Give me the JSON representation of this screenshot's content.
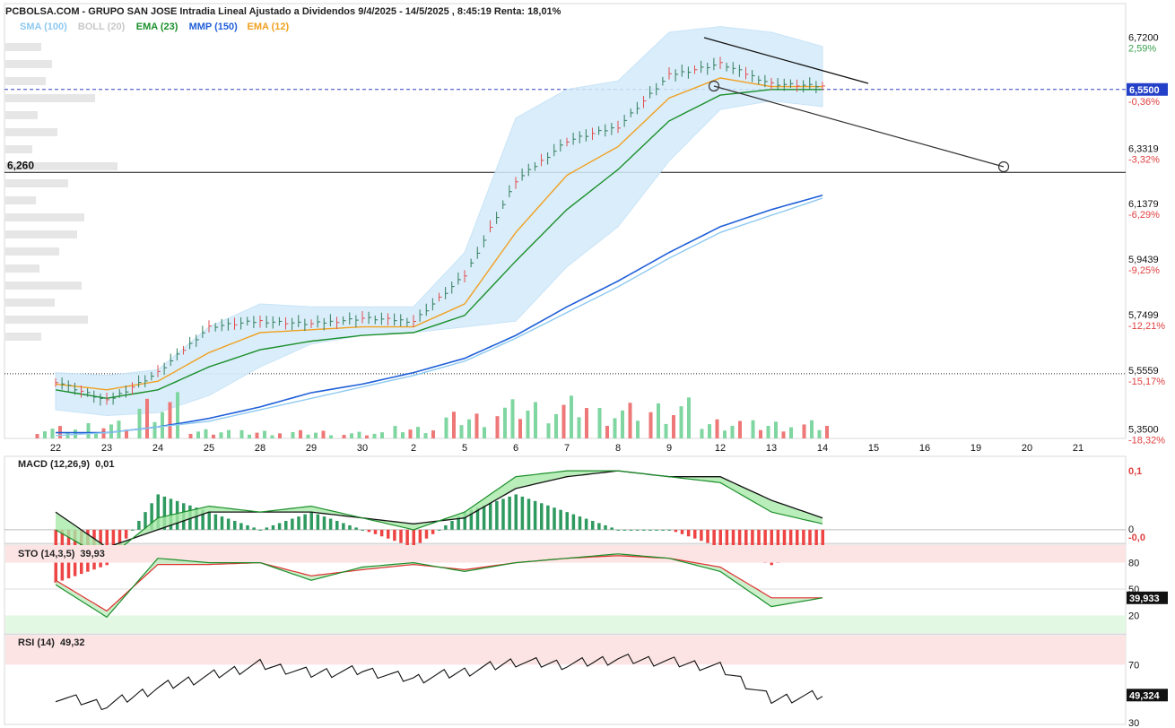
{
  "header": {
    "title": "PCBOLSA.COM - GRUPO SAN JOSE Intradia Lineal Ajustado a Dividendos 9/4/2025 - 14/5/2025 , 8:45:19 Renta: 18,01%"
  },
  "legend": [
    {
      "label": "SMA (100)",
      "color": "#8ec9f0"
    },
    {
      "label": "BOLL (20)",
      "color": "#c8c8c8"
    },
    {
      "label": "EMA (23)",
      "color": "#1a8f2a"
    },
    {
      "label": "MMP (150)",
      "color": "#1f5fd8"
    },
    {
      "label": "EMA (12)",
      "color": "#f0a020"
    }
  ],
  "price_axis": {
    "ticks": [
      {
        "price": "6,7200",
        "pct": "2,59%",
        "y": 6.72
      },
      {
        "price": "6,3319",
        "pct": "-3,32%",
        "y": 6.3319
      },
      {
        "price": "6,1379",
        "pct": "-6,29%",
        "y": 6.1379
      },
      {
        "price": "5,9439",
        "pct": "-9,25%",
        "y": 5.9439
      },
      {
        "price": "5,7499",
        "pct": "-12,21%",
        "y": 5.7499
      },
      {
        "price": "5,5559",
        "pct": "-15,17%",
        "y": 5.5559
      },
      {
        "price": "5,3500",
        "pct": "-18,32%",
        "y": 5.35
      }
    ],
    "current_price": "6,5500",
    "current_pct": "-0,36%",
    "current_value": 6.55,
    "level_label": "6,260",
    "level_value": 6.26,
    "dotted_level": 5.5559
  },
  "x_axis": {
    "labels": [
      "22",
      "23",
      "24",
      "25",
      "28",
      "29",
      "30",
      "2",
      "5",
      "6",
      "7",
      "8",
      "9",
      "12",
      "13",
      "14",
      "15",
      "16",
      "19",
      "20",
      "21"
    ]
  },
  "macd": {
    "label": "MACD (12,26,9)",
    "value": "0,01",
    "axis_top": "0,1",
    "axis_zero": "0",
    "badge": "-0,0"
  },
  "sto": {
    "label": "STO (14,3,5)",
    "value": "39,93",
    "ticks": [
      "80",
      "50",
      "20"
    ],
    "badge": "39,933"
  },
  "rsi": {
    "label": "RSI (14)",
    "value": "49,32",
    "ticks": [
      "70",
      "30"
    ],
    "badge": "49,324"
  },
  "chart_data": {
    "type": "line",
    "title": "GRUPO SAN JOSE Intradia Lineal Ajustado a Dividendos 9/4/2025 - 14/5/2025",
    "x_categories": [
      "22",
      "23",
      "24",
      "25",
      "28",
      "29",
      "30",
      "2",
      "5",
      "6",
      "7",
      "8",
      "9",
      "12",
      "13",
      "14"
    ],
    "future_categories": [
      "15",
      "16",
      "19",
      "20",
      "21"
    ],
    "ylim": [
      5.33,
      6.8
    ],
    "series": [
      {
        "name": "Precio",
        "values": [
          5.53,
          5.46,
          5.56,
          5.72,
          5.74,
          5.73,
          5.75,
          5.74,
          5.9,
          6.23,
          6.37,
          6.42,
          6.6,
          6.64,
          6.57,
          6.56
        ]
      },
      {
        "name": "EMA (12)",
        "values": [
          5.52,
          5.5,
          5.53,
          5.63,
          5.7,
          5.71,
          5.72,
          5.72,
          5.8,
          6.05,
          6.25,
          6.35,
          6.52,
          6.59,
          6.56,
          6.56
        ]
      },
      {
        "name": "EMA (23)",
        "values": [
          5.5,
          5.47,
          5.5,
          5.58,
          5.64,
          5.67,
          5.69,
          5.7,
          5.76,
          5.95,
          6.13,
          6.27,
          6.44,
          6.53,
          6.55,
          6.55
        ]
      },
      {
        "name": "MMP (150)",
        "values": [
          5.35,
          5.35,
          5.37,
          5.4,
          5.44,
          5.49,
          5.52,
          5.56,
          5.61,
          5.69,
          5.79,
          5.88,
          5.98,
          6.07,
          6.13,
          6.18
        ]
      },
      {
        "name": "SMA (100)",
        "values": [
          5.34,
          5.35,
          5.37,
          5.39,
          5.43,
          5.47,
          5.51,
          5.55,
          5.6,
          5.68,
          5.77,
          5.86,
          5.96,
          6.05,
          6.11,
          6.17
        ]
      },
      {
        "name": "BOLL (20) sup",
        "values": [
          5.56,
          5.55,
          5.57,
          5.72,
          5.8,
          5.79,
          5.79,
          5.79,
          5.98,
          6.45,
          6.55,
          6.58,
          6.75,
          6.77,
          6.75,
          6.7
        ]
      },
      {
        "name": "BOLL (20) inf",
        "values": [
          5.43,
          5.41,
          5.42,
          5.48,
          5.58,
          5.66,
          5.69,
          5.7,
          5.72,
          5.74,
          5.93,
          6.07,
          6.3,
          6.48,
          6.51,
          6.49
        ]
      }
    ],
    "volume": [
      14,
      20,
      52,
      12,
      10,
      10,
      8,
      14,
      30,
      44,
      48,
      40,
      46,
      25,
      22,
      22
    ],
    "macd": {
      "macd_line": [
        0.0,
        -0.05,
        0.02,
        0.04,
        0.03,
        0.04,
        0.02,
        0.0,
        0.03,
        0.09,
        0.1,
        0.1,
        0.09,
        0.08,
        0.03,
        0.01
      ],
      "signal_line": [
        0.03,
        -0.03,
        0.0,
        0.03,
        0.03,
        0.03,
        0.02,
        0.01,
        0.02,
        0.07,
        0.09,
        0.1,
        0.09,
        0.09,
        0.05,
        0.02
      ],
      "ylim": [
        -0.02,
        0.12
      ]
    },
    "sto": {
      "k": [
        55,
        18,
        85,
        80,
        80,
        60,
        75,
        80,
        70,
        80,
        85,
        90,
        85,
        70,
        30,
        40
      ],
      "d": [
        60,
        25,
        78,
        78,
        80,
        65,
        72,
        78,
        72,
        80,
        85,
        88,
        85,
        75,
        40,
        40
      ],
      "ylim": [
        0,
        100
      ]
    },
    "rsi": {
      "values": [
        48,
        42,
        54,
        62,
        70,
        64,
        66,
        60,
        65,
        72,
        70,
        74,
        72,
        68,
        46,
        49
      ],
      "ylim": [
        30,
        90
      ]
    }
  }
}
